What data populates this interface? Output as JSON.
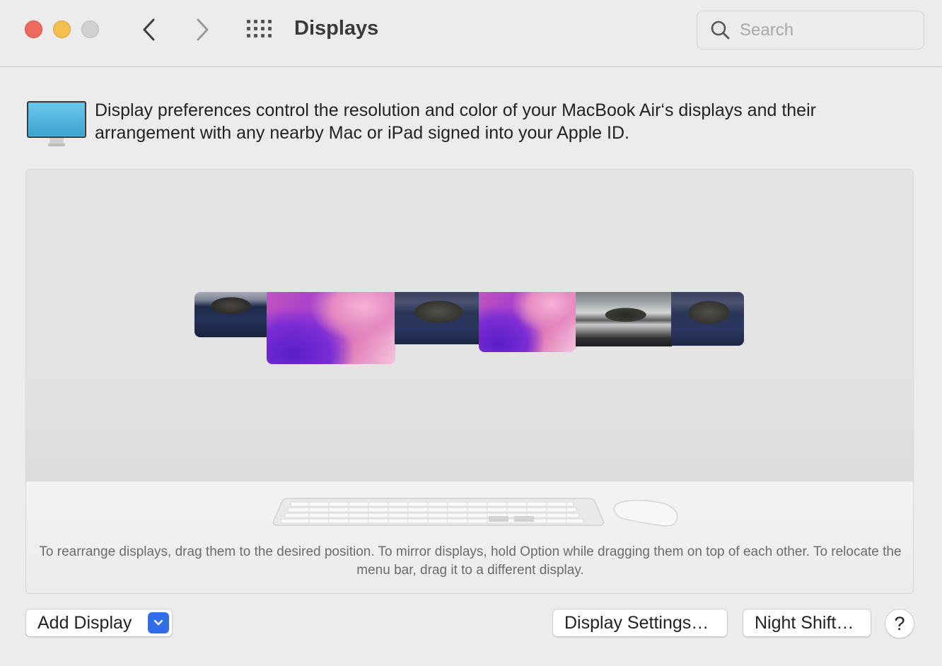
{
  "window": {
    "title": "Displays",
    "controls": [
      "close",
      "minimize",
      "zoom"
    ]
  },
  "toolbar": {
    "back_icon": "chevron-left-icon",
    "forward_icon": "chevron-right-icon",
    "show_all_icon": "grid-icon",
    "search": {
      "placeholder": "Search",
      "value": ""
    }
  },
  "intro": {
    "icon": "display-icon",
    "text": "Display preferences control the resolution and color of your MacBook Air‘s displays and their arrangement with any nearby Mac or iPad signed into your Apple ID."
  },
  "arrangement": {
    "displays": [
      {
        "name": "display-1",
        "wallpaper": "catalina"
      },
      {
        "name": "display-2",
        "wallpaper": "monterey"
      },
      {
        "name": "display-3",
        "wallpaper": "catalina"
      },
      {
        "name": "display-4",
        "wallpaper": "monterey"
      },
      {
        "name": "display-5",
        "wallpaper": "seascape"
      },
      {
        "name": "display-6",
        "wallpaper": "catalina"
      }
    ],
    "peripherals": [
      "keyboard-icon",
      "mouse-icon"
    ],
    "hint": "To rearrange displays, drag them to the desired position. To mirror displays, hold Option while dragging them on top of each other. To relocate the menu bar, drag it to a different display."
  },
  "footer": {
    "add_display_label": "Add Display",
    "display_settings_label": "Display Settings…",
    "night_shift_label": "Night Shift…",
    "help_label": "?"
  },
  "colors": {
    "close": "#ed6a5e",
    "minimize": "#f4bf4f",
    "zoom": "#d0d0d0",
    "accent": "#2f6ee8"
  }
}
